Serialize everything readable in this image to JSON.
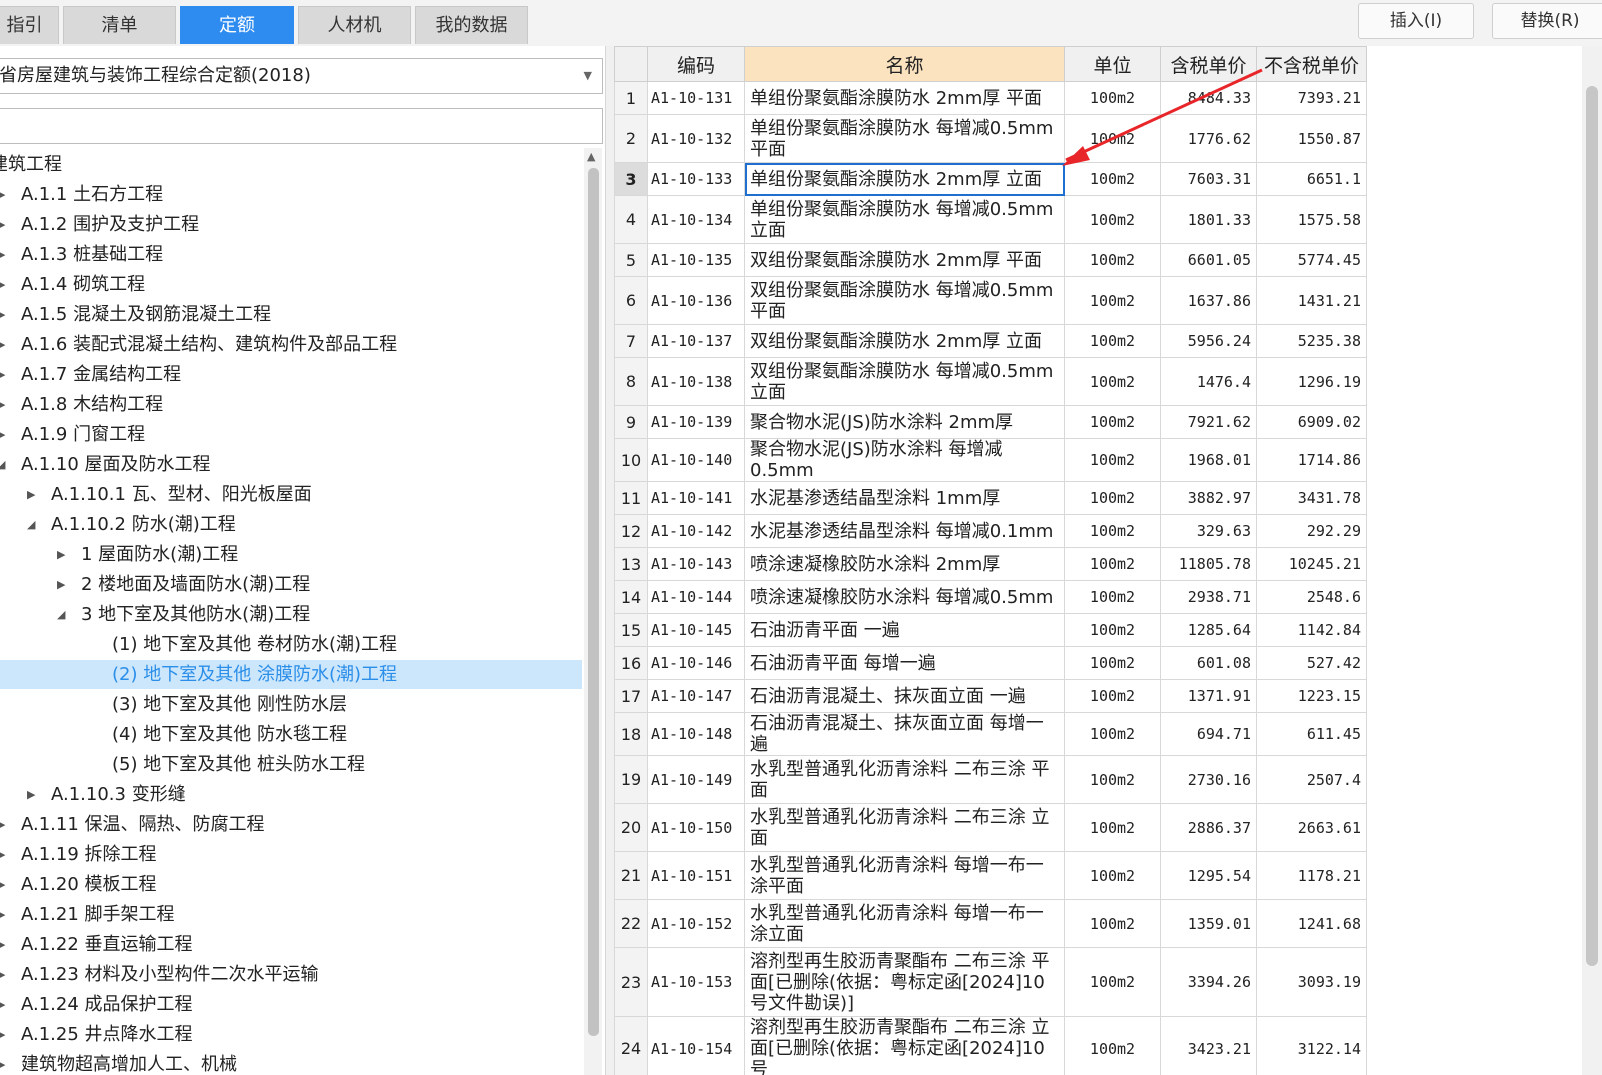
{
  "tabs": [
    {
      "label": "指引"
    },
    {
      "label": "清单"
    },
    {
      "label": "定额"
    },
    {
      "label": "人材机"
    },
    {
      "label": "我的数据"
    }
  ],
  "actions": {
    "insert": "插入(I)",
    "replace": "替换(R)"
  },
  "library": {
    "selected": "省房屋建筑与装饰工程综合定额(2018)",
    "search_value": ""
  },
  "tree": [
    {
      "label": "建筑工程"
    },
    {
      "label": "A.1.1 土石方工程"
    },
    {
      "label": "A.1.2 围护及支护工程"
    },
    {
      "label": "A.1.3 桩基础工程"
    },
    {
      "label": "A.1.4 砌筑工程"
    },
    {
      "label": "A.1.5 混凝土及钢筋混凝土工程"
    },
    {
      "label": "A.1.6 装配式混凝土结构、建筑构件及部品工程"
    },
    {
      "label": "A.1.7 金属结构工程"
    },
    {
      "label": "A.1.8 木结构工程"
    },
    {
      "label": "A.1.9 门窗工程"
    },
    {
      "label": "A.1.10 屋面及防水工程"
    },
    {
      "label": "A.1.10.1 瓦、型材、阳光板屋面"
    },
    {
      "label": "A.1.10.2 防水(潮)工程"
    },
    {
      "label": "1 屋面防水(潮)工程"
    },
    {
      "label": "2 楼地面及墙面防水(潮)工程"
    },
    {
      "label": "3 地下室及其他防水(潮)工程"
    },
    {
      "label": "(1) 地下室及其他 卷材防水(潮)工程"
    },
    {
      "label": "(2) 地下室及其他 涂膜防水(潮)工程"
    },
    {
      "label": "(3) 地下室及其他 刚性防水层"
    },
    {
      "label": "(4) 地下室及其他 防水毯工程"
    },
    {
      "label": "(5) 地下室及其他 桩头防水工程"
    },
    {
      "label": "A.1.10.3 变形缝"
    },
    {
      "label": "A.1.11 保温、隔热、防腐工程"
    },
    {
      "label": "A.1.19 拆除工程"
    },
    {
      "label": "A.1.20 模板工程"
    },
    {
      "label": "A.1.21 脚手架工程"
    },
    {
      "label": "A.1.22 垂直运输工程"
    },
    {
      "label": "A.1.23 材料及小型构件二次水平运输"
    },
    {
      "label": "A.1.24 成品保护工程"
    },
    {
      "label": "A.1.25 井点降水工程"
    },
    {
      "label": "建筑物超高增加人工、机械"
    }
  ],
  "grid": {
    "columns": [
      "编码",
      "名称",
      "单位",
      "含税单价",
      "不含税单价"
    ],
    "rows": [
      {
        "n": "1",
        "code": "A1-10-131",
        "name": "单组份聚氨酯涂膜防水 2mm厚 平面",
        "unit": "100m2",
        "price_tax": "8484.33",
        "price_notax": "7393.21"
      },
      {
        "n": "2",
        "code": "A1-10-132",
        "name": "单组份聚氨酯涂膜防水 每增减0.5mm 平面",
        "unit": "100m2",
        "price_tax": "1776.62",
        "price_notax": "1550.87"
      },
      {
        "n": "3",
        "code": "A1-10-133",
        "name": "单组份聚氨酯涂膜防水 2mm厚 立面",
        "unit": "100m2",
        "price_tax": "7603.31",
        "price_notax": "6651.1"
      },
      {
        "n": "4",
        "code": "A1-10-134",
        "name": "单组份聚氨酯涂膜防水 每增减0.5mm 立面",
        "unit": "100m2",
        "price_tax": "1801.33",
        "price_notax": "1575.58"
      },
      {
        "n": "5",
        "code": "A1-10-135",
        "name": "双组份聚氨酯涂膜防水 2mm厚 平面",
        "unit": "100m2",
        "price_tax": "6601.05",
        "price_notax": "5774.45"
      },
      {
        "n": "6",
        "code": "A1-10-136",
        "name": "双组份聚氨酯涂膜防水 每增减0.5mm 平面",
        "unit": "100m2",
        "price_tax": "1637.86",
        "price_notax": "1431.21"
      },
      {
        "n": "7",
        "code": "A1-10-137",
        "name": "双组份聚氨酯涂膜防水 2mm厚 立面",
        "unit": "100m2",
        "price_tax": "5956.24",
        "price_notax": "5235.38"
      },
      {
        "n": "8",
        "code": "A1-10-138",
        "name": "双组份聚氨酯涂膜防水 每增减0.5mm 立面",
        "unit": "100m2",
        "price_tax": "1476.4",
        "price_notax": "1296.19"
      },
      {
        "n": "9",
        "code": "A1-10-139",
        "name": "聚合物水泥(JS)防水涂料 2mm厚",
        "unit": "100m2",
        "price_tax": "7921.62",
        "price_notax": "6909.02"
      },
      {
        "n": "10",
        "code": "A1-10-140",
        "name": "聚合物水泥(JS)防水涂料 每增减0.5mm",
        "unit": "100m2",
        "price_tax": "1968.01",
        "price_notax": "1714.86"
      },
      {
        "n": "11",
        "code": "A1-10-141",
        "name": "水泥基渗透结晶型涂料 1mm厚",
        "unit": "100m2",
        "price_tax": "3882.97",
        "price_notax": "3431.78"
      },
      {
        "n": "12",
        "code": "A1-10-142",
        "name": "水泥基渗透结晶型涂料 每增减0.1mm",
        "unit": "100m2",
        "price_tax": "329.63",
        "price_notax": "292.29"
      },
      {
        "n": "13",
        "code": "A1-10-143",
        "name": "喷涂速凝橡胶防水涂料 2mm厚",
        "unit": "100m2",
        "price_tax": "11805.78",
        "price_notax": "10245.21"
      },
      {
        "n": "14",
        "code": "A1-10-144",
        "name": "喷涂速凝橡胶防水涂料 每增减0.5mm",
        "unit": "100m2",
        "price_tax": "2938.71",
        "price_notax": "2548.6"
      },
      {
        "n": "15",
        "code": "A1-10-145",
        "name": "石油沥青平面 一遍",
        "unit": "100m2",
        "price_tax": "1285.64",
        "price_notax": "1142.84"
      },
      {
        "n": "16",
        "code": "A1-10-146",
        "name": "石油沥青平面 每增一遍",
        "unit": "100m2",
        "price_tax": "601.08",
        "price_notax": "527.42"
      },
      {
        "n": "17",
        "code": "A1-10-147",
        "name": "石油沥青混凝土、抹灰面立面 一遍",
        "unit": "100m2",
        "price_tax": "1371.91",
        "price_notax": "1223.15"
      },
      {
        "n": "18",
        "code": "A1-10-148",
        "name": "石油沥青混凝土、抹灰面立面 每增一遍",
        "unit": "100m2",
        "price_tax": "694.71",
        "price_notax": "611.45"
      },
      {
        "n": "19",
        "code": "A1-10-149",
        "name": "水乳型普通乳化沥青涂料 二布三涂 平面",
        "unit": "100m2",
        "price_tax": "2730.16",
        "price_notax": "2507.4"
      },
      {
        "n": "20",
        "code": "A1-10-150",
        "name": "水乳型普通乳化沥青涂料 二布三涂 立面",
        "unit": "100m2",
        "price_tax": "2886.37",
        "price_notax": "2663.61"
      },
      {
        "n": "21",
        "code": "A1-10-151",
        "name": "水乳型普通乳化沥青涂料 每增一布一涂平面",
        "unit": "100m2",
        "price_tax": "1295.54",
        "price_notax": "1178.21"
      },
      {
        "n": "22",
        "code": "A1-10-152",
        "name": "水乳型普通乳化沥青涂料 每增一布一涂立面",
        "unit": "100m2",
        "price_tax": "1359.01",
        "price_notax": "1241.68"
      },
      {
        "n": "23",
        "code": "A1-10-153",
        "name": "溶剂型再生胶沥青聚酯布 二布三涂 平面[已删除(依据：粤标定函[2024]10号文件勘误)]",
        "unit": "100m2",
        "price_tax": "3394.26",
        "price_notax": "3093.19"
      },
      {
        "n": "24",
        "code": "A1-10-154",
        "name": "溶剂型再生胶沥青聚酯布 二布三涂 立面[已删除(依据：粤标定函[2024]10号",
        "unit": "100m2",
        "price_tax": "3423.21",
        "price_notax": "3122.14"
      }
    ]
  },
  "colors": {
    "accent": "#2e8bef",
    "selection": "#cce6fb",
    "annotation": "#e8262a"
  }
}
